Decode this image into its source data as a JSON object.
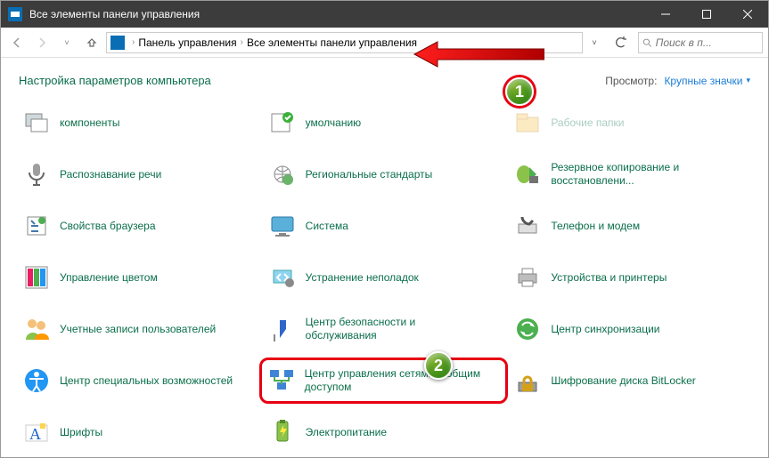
{
  "window": {
    "title": "Все элементы панели управления"
  },
  "nav": {
    "crumb1": "Панель управления",
    "crumb2": "Все элементы панели управления"
  },
  "search": {
    "placeholder": "Поиск в п..."
  },
  "heading": "Настройка параметров компьютера",
  "view": {
    "label": "Просмотр:",
    "choice": "Крупные значки"
  },
  "items": {
    "r0c0": "компоненты",
    "r0c1": "умолчанию",
    "r0c2": "Рабочие папки",
    "r1c0": "Распознавание речи",
    "r1c1": "Региональные стандарты",
    "r1c2": "Резервное копирование и восстановлени...",
    "r2c0": "Свойства браузера",
    "r2c1": "Система",
    "r2c2": "Телефон и модем",
    "r3c0": "Управление цветом",
    "r3c1": "Устранение неполадок",
    "r3c2": "Устройства и принтеры",
    "r4c0": "Учетные записи пользователей",
    "r4c1": "Центр безопасности и обслуживания",
    "r4c2": "Центр синхронизации",
    "r5c0": "Центр специальных возможностей",
    "r5c1": "Центр управления сетями и общим доступом",
    "r5c2": "Шифрование диска BitLocker",
    "r6c0": "Шрифты",
    "r6c1": "Электропитание"
  },
  "annotations": {
    "badge1": "1",
    "badge2": "2"
  }
}
